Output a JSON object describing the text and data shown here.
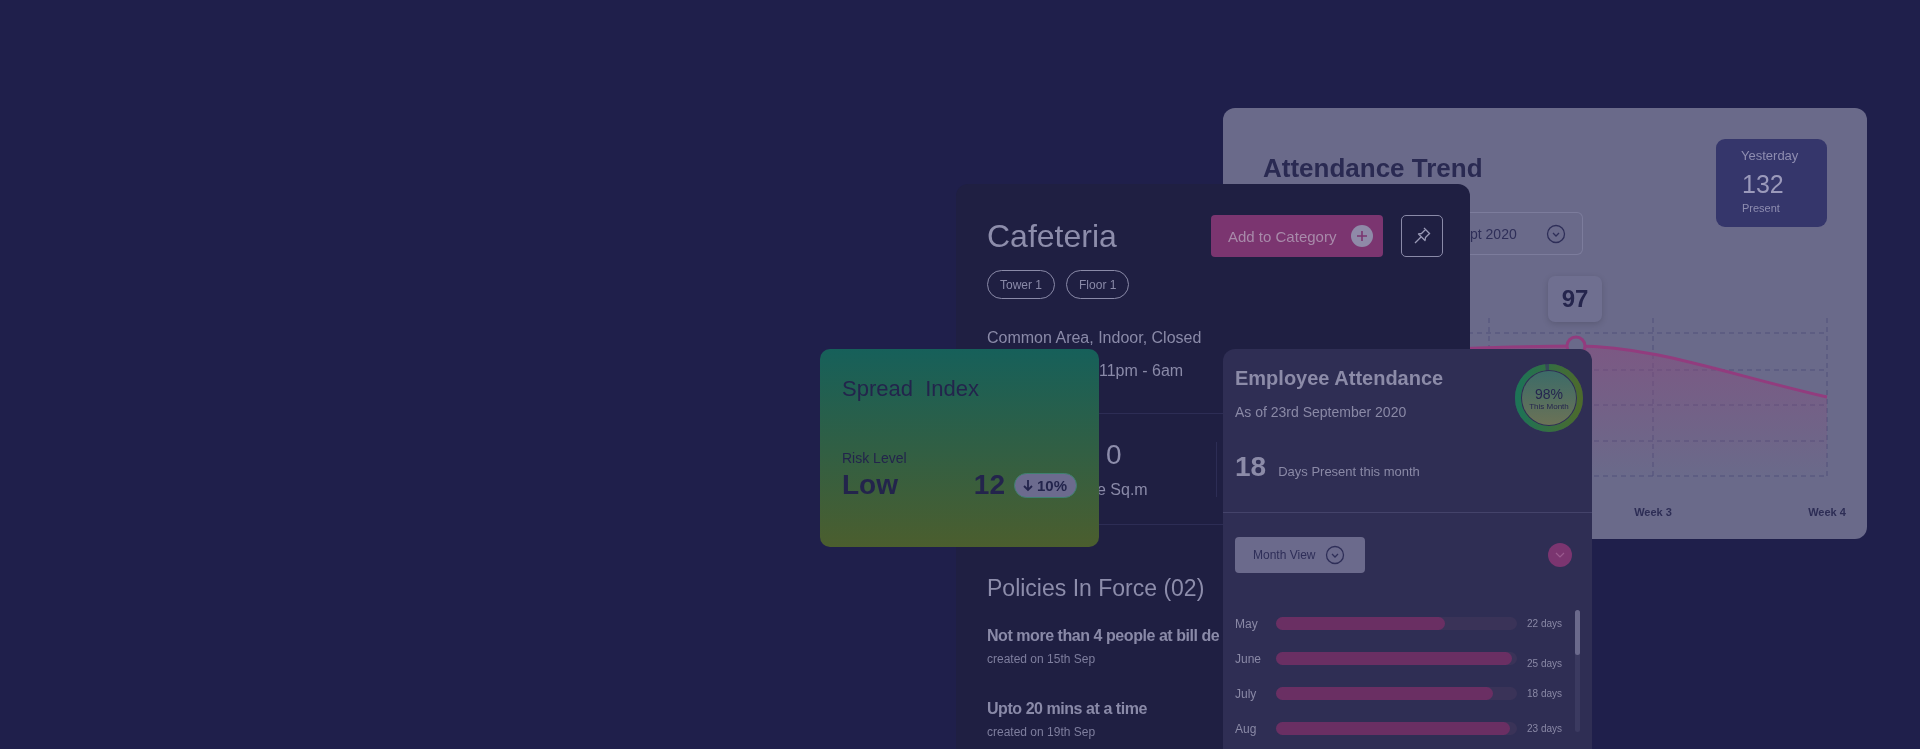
{
  "attendance_trend": {
    "title": "Attendance Trend",
    "yesterday": {
      "label": "Yesterday",
      "value": "132",
      "caption": "Present"
    },
    "period_dropdown": {
      "value": "pt 2020"
    },
    "chart": {
      "tooltip": "97",
      "x_labels": [
        "Week 3",
        "Week 4"
      ]
    }
  },
  "cafeteria": {
    "title": "Cafeteria",
    "add_button": "Add to Category",
    "tags": [
      "Tower 1",
      "Floor 1"
    ],
    "details": [
      "Common Area, Indoor, Closed",
      "11pm - 6am"
    ],
    "stats": {
      "value": "0",
      "label": "e Sq.m"
    },
    "policies": {
      "heading": "Policies In Force (02)",
      "items": [
        {
          "text": "Not more than 4 people at bill de",
          "created": "created on 15th Sep"
        },
        {
          "text": "Upto 20 mins at a time",
          "created": "created on 19th Sep"
        }
      ]
    }
  },
  "spread_index": {
    "title": "Spread  Index",
    "risk_label": "Risk Level",
    "risk_value": "Low",
    "score": "12",
    "change": "10%"
  },
  "employee_attendance": {
    "title": "Employee Attendance",
    "subtitle": "As of 23rd September 2020",
    "ring": {
      "value": "98%",
      "caption": "This Month",
      "level": 0.98
    },
    "days_present": {
      "value": "18",
      "label": "Days Present this month"
    },
    "view_dropdown": "Month View",
    "months": [
      {
        "label": "May",
        "level": 0.7,
        "days": "22 days"
      },
      {
        "label": "June",
        "level": 0.98,
        "days": "25 days"
      },
      {
        "label": "July",
        "level": 0.9,
        "days": "18 days"
      },
      {
        "label": "Aug",
        "level": 0.97,
        "days": "23 days"
      }
    ]
  }
}
